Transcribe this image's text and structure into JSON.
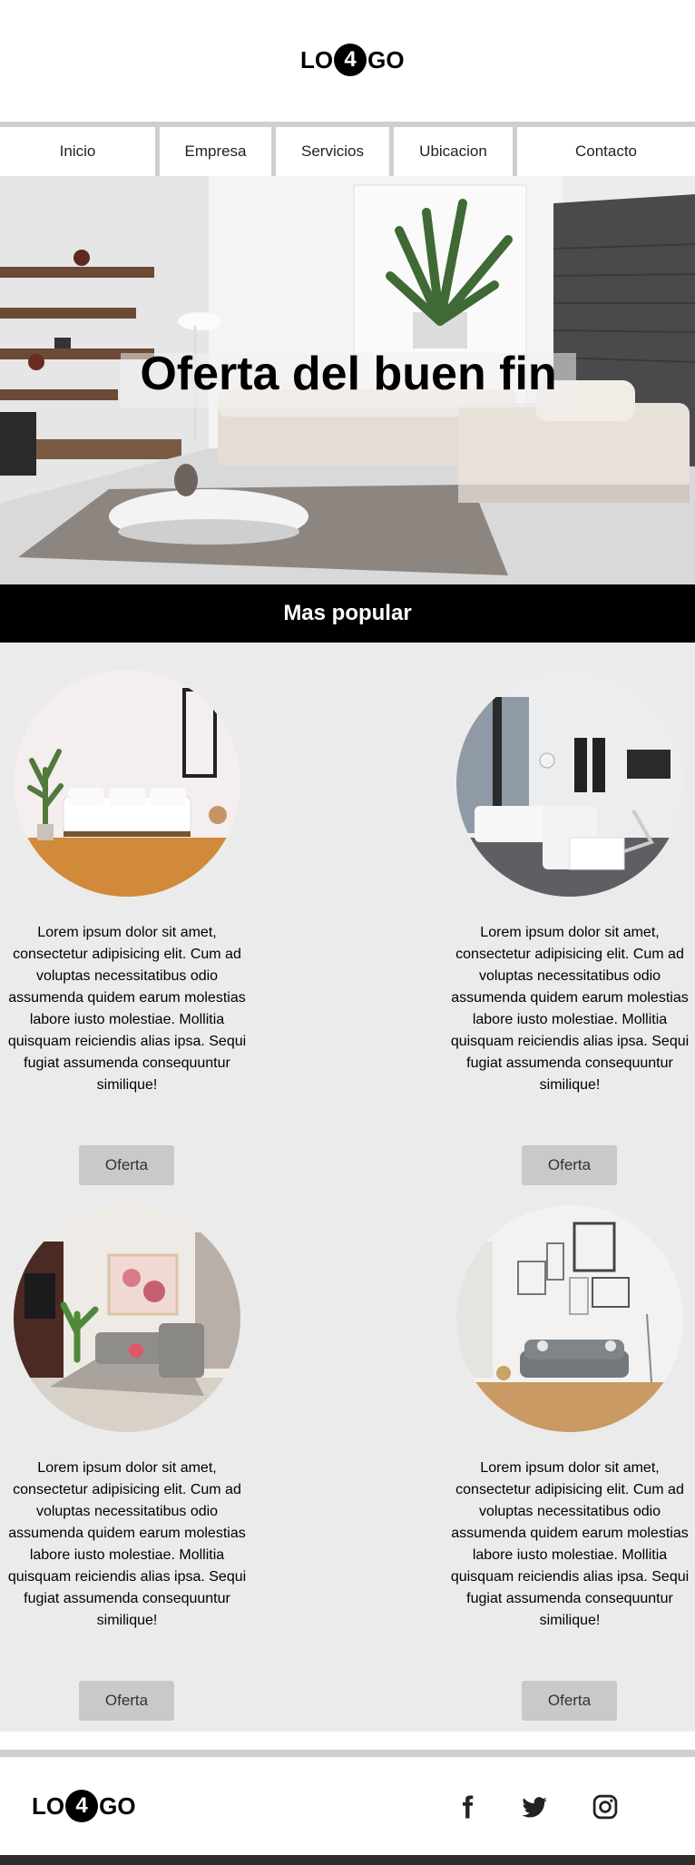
{
  "header": {
    "logo": {
      "left": "LO",
      "middle": "4",
      "right": "GO"
    }
  },
  "nav": {
    "items": [
      {
        "label": "Inicio"
      },
      {
        "label": "Empresa"
      },
      {
        "label": "Servicios"
      },
      {
        "label": "Ubicacion"
      },
      {
        "label": "Contacto"
      }
    ]
  },
  "hero": {
    "title": "Oferta del buen fin"
  },
  "popular": {
    "title": "Mas popular"
  },
  "products": [
    {
      "description": "Lorem ipsum dolor sit amet, consectetur adipisicing elit. Cum ad voluptas necessitatibus odio assumenda quidem earum molestias labore iusto molestiae. Mollitia quisquam reiciendis alias ipsa. Sequi fugiat assumenda consequuntur similique!",
      "button": "Oferta"
    },
    {
      "description": "Lorem ipsum dolor sit amet, consectetur adipisicing elit. Cum ad voluptas necessitatibus odio assumenda quidem earum molestias labore iusto molestiae. Mollitia quisquam reiciendis alias ipsa. Sequi fugiat assumenda consequuntur similique!",
      "button": "Oferta"
    },
    {
      "description": "Lorem ipsum dolor sit amet, consectetur adipisicing elit. Cum ad voluptas necessitatibus odio assumenda quidem earum molestias labore iusto molestiae. Mollitia quisquam reiciendis alias ipsa. Sequi fugiat assumenda consequuntur similique!",
      "button": "Oferta"
    },
    {
      "description": "Lorem ipsum dolor sit amet, consectetur adipisicing elit. Cum ad voluptas necessitatibus odio assumenda quidem earum molestias labore iusto molestiae. Mollitia quisquam reiciendis alias ipsa. Sequi fugiat assumenda consequuntur similique!",
      "button": "Oferta"
    }
  ],
  "footer": {
    "logo": {
      "left": "LO",
      "middle": "4",
      "right": "GO"
    },
    "social": [
      {
        "icon": "facebook-icon"
      },
      {
        "icon": "twitter-icon"
      },
      {
        "icon": "instagram-icon"
      }
    ]
  },
  "colors": {
    "banner": "#000000",
    "button": "#c9c9c9",
    "section_bg": "#ebebeb",
    "divider": "#cfcfcf"
  }
}
